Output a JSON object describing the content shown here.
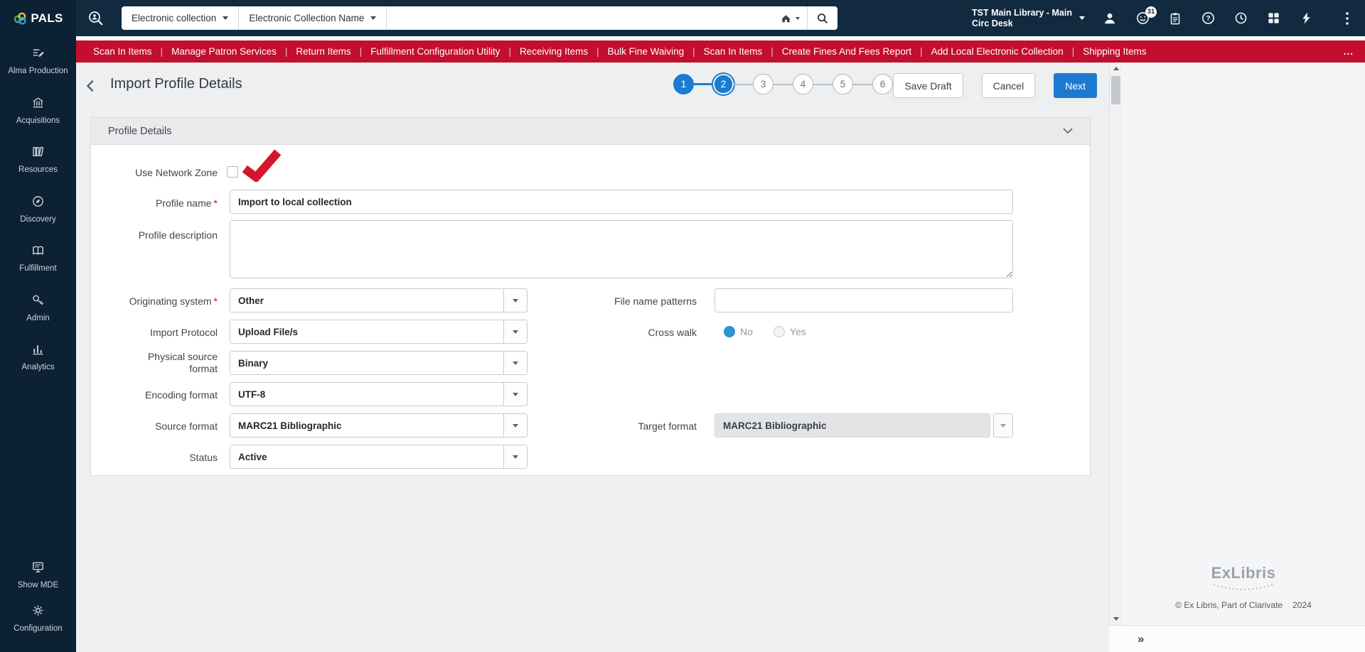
{
  "header": {
    "logo": "PALS",
    "scopes": [
      {
        "label": "Electronic collection"
      },
      {
        "label": "Electronic Collection Name"
      }
    ],
    "search_value": "",
    "location_line1": "TST Main Library - Main",
    "location_line2": "Circ Desk",
    "notification_count": "31"
  },
  "quick_links": {
    "items": [
      "Scan In Items",
      "Manage Patron Services",
      "Return Items",
      "Fulfillment Configuration Utility",
      "Receiving Items",
      "Bulk Fine Waiving",
      "Scan In Items",
      "Create Fines And Fees Report",
      "Add Local Electronic Collection",
      "Shipping Items"
    ],
    "more": "..."
  },
  "sidebar": {
    "items": [
      {
        "label": "Alma Production",
        "icon": "alma-production-icon"
      },
      {
        "label": "Acquisitions",
        "icon": "acquisitions-icon"
      },
      {
        "label": "Resources",
        "icon": "resources-icon"
      },
      {
        "label": "Discovery",
        "icon": "discovery-icon"
      },
      {
        "label": "Fulfillment",
        "icon": "fulfillment-icon"
      },
      {
        "label": "Admin",
        "icon": "admin-icon"
      },
      {
        "label": "Analytics",
        "icon": "analytics-icon"
      }
    ],
    "bottom_items": [
      {
        "label": "Show MDE",
        "icon": "show-mde-icon"
      },
      {
        "label": "Configuration",
        "icon": "gear-icon"
      }
    ]
  },
  "page": {
    "title": "Import Profile Details",
    "steps": [
      "1",
      "2",
      "3",
      "4",
      "5",
      "6"
    ],
    "active_step": "2",
    "save_draft_label": "Save Draft",
    "cancel_label": "Cancel",
    "next_label": "Next"
  },
  "panel": {
    "title": "Profile Details"
  },
  "form": {
    "use_network_zone": {
      "label": "Use Network Zone",
      "checked": false
    },
    "profile_name": {
      "label": "Profile name",
      "required": "*",
      "value": "Import to local collection"
    },
    "profile_description": {
      "label": "Profile description",
      "value": ""
    },
    "originating_system": {
      "label": "Originating system",
      "required": "*",
      "value": "Other"
    },
    "file_name_patterns": {
      "label": "File name patterns",
      "value": ""
    },
    "import_protocol": {
      "label": "Import Protocol",
      "value": "Upload File/s"
    },
    "cross_walk": {
      "label": "Cross walk",
      "no_label": "No",
      "yes_label": "Yes",
      "selected": "No"
    },
    "physical_source_format": {
      "label": "Physical source format",
      "value": "Binary"
    },
    "encoding_format": {
      "label": "Encoding format",
      "value": "UTF-8"
    },
    "source_format": {
      "label": "Source format",
      "value": "MARC21 Bibliographic"
    },
    "target_format": {
      "label": "Target format",
      "value": "MARC21 Bibliographic",
      "disabled": true
    },
    "status": {
      "label": "Status",
      "value": "Active"
    }
  },
  "footer": {
    "brand": "ExLibris",
    "copyright": "© Ex Libris, Part of Clarivate",
    "year": "2024",
    "expand": "»"
  },
  "colors": {
    "header_navy": "#122a40",
    "sidebar_navy": "#0c2133",
    "quicklinks_red": "#c30e2d",
    "accent_blue": "#1b7bd0",
    "radio_selected_blue": "#2e94d6",
    "annotation_red": "#d5152b"
  }
}
